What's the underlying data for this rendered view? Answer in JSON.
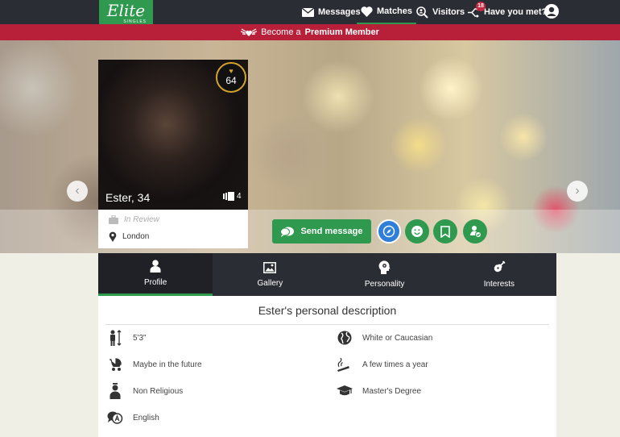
{
  "header": {
    "logo_text": "Elite",
    "logo_sub": "SINGLES",
    "nav": [
      {
        "label": "Messages",
        "icon": "envelope-icon"
      },
      {
        "label": "Matches",
        "icon": "heart-icon",
        "active": true
      },
      {
        "label": "Visitors",
        "icon": "magnifier-person-icon"
      },
      {
        "label": "Have you met?",
        "icon": "split-arrow-icon",
        "badge": "18"
      }
    ],
    "avatar_icon": "user-avatar-icon"
  },
  "promo": {
    "prefix": "Become a",
    "bold": "Premium Member",
    "icon": "winged-heart-icon"
  },
  "profile": {
    "name": "Ester, 34",
    "score": "64",
    "photo_count": "4",
    "status": "In Review",
    "location": "London"
  },
  "actions": {
    "send_message": "Send message",
    "buttons": [
      "compass-icon",
      "smile-icon",
      "bookmark-icon",
      "person-check-icon"
    ]
  },
  "tabs": [
    {
      "label": "Profile",
      "icon": "person-icon",
      "active": true
    },
    {
      "label": "Gallery",
      "icon": "image-icon"
    },
    {
      "label": "Personality",
      "icon": "head-gear-icon"
    },
    {
      "label": "Interests",
      "icon": "guitar-icon"
    }
  ],
  "description": {
    "title": "Ester's personal description",
    "left": [
      {
        "icon": "height-icon",
        "value": "5'3\""
      },
      {
        "icon": "stroller-icon",
        "value": "Maybe in the future"
      },
      {
        "icon": "religion-icon",
        "value": "Non Religious"
      },
      {
        "icon": "language-icon",
        "value": "English"
      }
    ],
    "right": [
      {
        "icon": "globe-icon",
        "value": "White or Caucasian"
      },
      {
        "icon": "cigarette-icon",
        "value": "A few times a year"
      },
      {
        "icon": "graduation-cap-icon",
        "value": "Master's Degree"
      }
    ]
  },
  "colors": {
    "brand_green": "#2f9a4f",
    "promo_red": "#b8203a",
    "dark": "#2b2d35",
    "gold": "#d4a22f",
    "blue": "#2f7fd8"
  }
}
